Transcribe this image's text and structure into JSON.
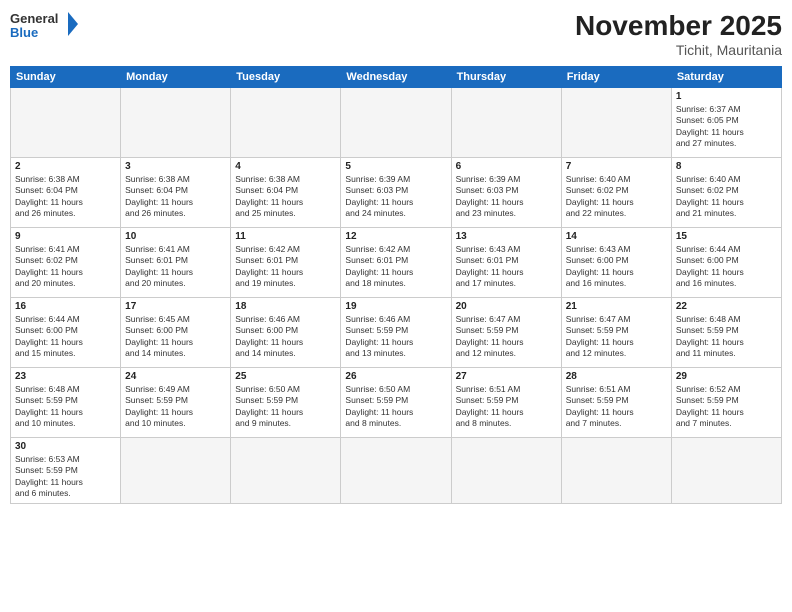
{
  "header": {
    "logo_general": "General",
    "logo_blue": "Blue",
    "month_title": "November 2025",
    "subtitle": "Tichit, Mauritania"
  },
  "weekdays": [
    "Sunday",
    "Monday",
    "Tuesday",
    "Wednesday",
    "Thursday",
    "Friday",
    "Saturday"
  ],
  "weeks": [
    [
      {
        "day": "",
        "info": ""
      },
      {
        "day": "",
        "info": ""
      },
      {
        "day": "",
        "info": ""
      },
      {
        "day": "",
        "info": ""
      },
      {
        "day": "",
        "info": ""
      },
      {
        "day": "",
        "info": ""
      },
      {
        "day": "1",
        "info": "Sunrise: 6:37 AM\nSunset: 6:05 PM\nDaylight: 11 hours\nand 27 minutes."
      }
    ],
    [
      {
        "day": "2",
        "info": "Sunrise: 6:38 AM\nSunset: 6:04 PM\nDaylight: 11 hours\nand 26 minutes."
      },
      {
        "day": "3",
        "info": "Sunrise: 6:38 AM\nSunset: 6:04 PM\nDaylight: 11 hours\nand 26 minutes."
      },
      {
        "day": "4",
        "info": "Sunrise: 6:38 AM\nSunset: 6:04 PM\nDaylight: 11 hours\nand 25 minutes."
      },
      {
        "day": "5",
        "info": "Sunrise: 6:39 AM\nSunset: 6:03 PM\nDaylight: 11 hours\nand 24 minutes."
      },
      {
        "day": "6",
        "info": "Sunrise: 6:39 AM\nSunset: 6:03 PM\nDaylight: 11 hours\nand 23 minutes."
      },
      {
        "day": "7",
        "info": "Sunrise: 6:40 AM\nSunset: 6:02 PM\nDaylight: 11 hours\nand 22 minutes."
      },
      {
        "day": "8",
        "info": "Sunrise: 6:40 AM\nSunset: 6:02 PM\nDaylight: 11 hours\nand 21 minutes."
      }
    ],
    [
      {
        "day": "9",
        "info": "Sunrise: 6:41 AM\nSunset: 6:02 PM\nDaylight: 11 hours\nand 20 minutes."
      },
      {
        "day": "10",
        "info": "Sunrise: 6:41 AM\nSunset: 6:01 PM\nDaylight: 11 hours\nand 20 minutes."
      },
      {
        "day": "11",
        "info": "Sunrise: 6:42 AM\nSunset: 6:01 PM\nDaylight: 11 hours\nand 19 minutes."
      },
      {
        "day": "12",
        "info": "Sunrise: 6:42 AM\nSunset: 6:01 PM\nDaylight: 11 hours\nand 18 minutes."
      },
      {
        "day": "13",
        "info": "Sunrise: 6:43 AM\nSunset: 6:01 PM\nDaylight: 11 hours\nand 17 minutes."
      },
      {
        "day": "14",
        "info": "Sunrise: 6:43 AM\nSunset: 6:00 PM\nDaylight: 11 hours\nand 16 minutes."
      },
      {
        "day": "15",
        "info": "Sunrise: 6:44 AM\nSunset: 6:00 PM\nDaylight: 11 hours\nand 16 minutes."
      }
    ],
    [
      {
        "day": "16",
        "info": "Sunrise: 6:44 AM\nSunset: 6:00 PM\nDaylight: 11 hours\nand 15 minutes."
      },
      {
        "day": "17",
        "info": "Sunrise: 6:45 AM\nSunset: 6:00 PM\nDaylight: 11 hours\nand 14 minutes."
      },
      {
        "day": "18",
        "info": "Sunrise: 6:46 AM\nSunset: 6:00 PM\nDaylight: 11 hours\nand 14 minutes."
      },
      {
        "day": "19",
        "info": "Sunrise: 6:46 AM\nSunset: 5:59 PM\nDaylight: 11 hours\nand 13 minutes."
      },
      {
        "day": "20",
        "info": "Sunrise: 6:47 AM\nSunset: 5:59 PM\nDaylight: 11 hours\nand 12 minutes."
      },
      {
        "day": "21",
        "info": "Sunrise: 6:47 AM\nSunset: 5:59 PM\nDaylight: 11 hours\nand 12 minutes."
      },
      {
        "day": "22",
        "info": "Sunrise: 6:48 AM\nSunset: 5:59 PM\nDaylight: 11 hours\nand 11 minutes."
      }
    ],
    [
      {
        "day": "23",
        "info": "Sunrise: 6:48 AM\nSunset: 5:59 PM\nDaylight: 11 hours\nand 10 minutes."
      },
      {
        "day": "24",
        "info": "Sunrise: 6:49 AM\nSunset: 5:59 PM\nDaylight: 11 hours\nand 10 minutes."
      },
      {
        "day": "25",
        "info": "Sunrise: 6:50 AM\nSunset: 5:59 PM\nDaylight: 11 hours\nand 9 minutes."
      },
      {
        "day": "26",
        "info": "Sunrise: 6:50 AM\nSunset: 5:59 PM\nDaylight: 11 hours\nand 8 minutes."
      },
      {
        "day": "27",
        "info": "Sunrise: 6:51 AM\nSunset: 5:59 PM\nDaylight: 11 hours\nand 8 minutes."
      },
      {
        "day": "28",
        "info": "Sunrise: 6:51 AM\nSunset: 5:59 PM\nDaylight: 11 hours\nand 7 minutes."
      },
      {
        "day": "29",
        "info": "Sunrise: 6:52 AM\nSunset: 5:59 PM\nDaylight: 11 hours\nand 7 minutes."
      }
    ],
    [
      {
        "day": "30",
        "info": "Sunrise: 6:53 AM\nSunset: 5:59 PM\nDaylight: 11 hours\nand 6 minutes."
      },
      {
        "day": "",
        "info": ""
      },
      {
        "day": "",
        "info": ""
      },
      {
        "day": "",
        "info": ""
      },
      {
        "day": "",
        "info": ""
      },
      {
        "day": "",
        "info": ""
      },
      {
        "day": "",
        "info": ""
      }
    ]
  ]
}
